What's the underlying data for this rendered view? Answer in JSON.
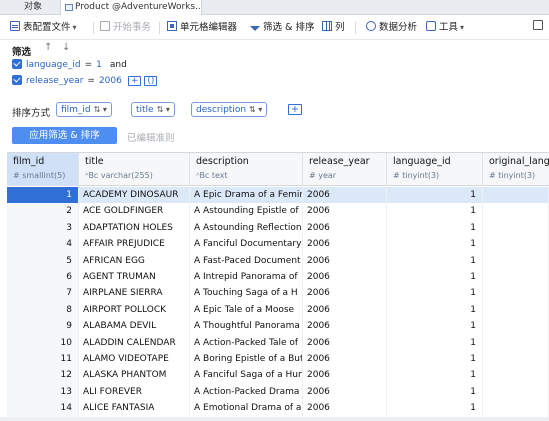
{
  "tabs": [
    {
      "label": "对象"
    },
    {
      "label": "Product @AdventureWorks..."
    }
  ],
  "toolbar": {
    "config_file": "表配置文件",
    "begin_txn": "开始事务",
    "cell_editor": "单元格编辑器",
    "filter_sort": "筛选 & 排序",
    "columns": "列",
    "data_analysis": "数据分析",
    "tools": "工具"
  },
  "filter": {
    "title": "筛选",
    "conditions": [
      {
        "field": "language_id",
        "op": "=",
        "value": "1",
        "logic": "and"
      },
      {
        "field": "release_year",
        "op": "=",
        "value": "2006",
        "add": "+",
        "expr": "()"
      }
    ]
  },
  "sort": {
    "label": "排序方式",
    "fields": [
      "film_id",
      "title",
      "description"
    ],
    "add": "+",
    "apply_button": "应用筛选 & 排序",
    "edited_text": "已编辑准则"
  },
  "grid": {
    "columns": [
      {
        "name": "film_id",
        "type": "smallint(5)",
        "type_icon": "#"
      },
      {
        "name": "title",
        "type": "varchar(255)",
        "type_icon": "ᴬBc"
      },
      {
        "name": "description",
        "type": "text",
        "type_icon": "ᴬBc"
      },
      {
        "name": "release_year",
        "type": "year",
        "type_icon": "#"
      },
      {
        "name": "language_id",
        "type": "tinyint(3)",
        "type_icon": "#"
      },
      {
        "name": "original_langu",
        "type": "tinyint(3)",
        "type_icon": "#"
      }
    ],
    "rows": [
      [
        "1",
        "ACADEMY DINOSAUR",
        "A Epic Drama of a Femin",
        "2006",
        "1",
        ""
      ],
      [
        "2",
        "ACE GOLDFINGER",
        "A Astounding Epistle of",
        "2006",
        "1",
        ""
      ],
      [
        "3",
        "ADAPTATION HOLES",
        "A Astounding Reflection",
        "2006",
        "1",
        ""
      ],
      [
        "4",
        "AFFAIR PREJUDICE",
        "A Fanciful Documentary",
        "2006",
        "1",
        ""
      ],
      [
        "5",
        "AFRICAN EGG",
        "A Fast-Paced Document",
        "2006",
        "1",
        ""
      ],
      [
        "6",
        "AGENT TRUMAN",
        "A Intrepid Panorama of",
        "2006",
        "1",
        ""
      ],
      [
        "7",
        "AIRPLANE SIERRA",
        "A Touching Saga of a H",
        "2006",
        "1",
        ""
      ],
      [
        "8",
        "AIRPORT POLLOCK",
        "A Epic Tale of a Moose",
        "2006",
        "1",
        ""
      ],
      [
        "9",
        "ALABAMA DEVIL",
        "A Thoughtful Panorama",
        "2006",
        "1",
        ""
      ],
      [
        "10",
        "ALADDIN CALENDAR",
        "A Action-Packed Tale of",
        "2006",
        "1",
        ""
      ],
      [
        "11",
        "ALAMO VIDEOTAPE",
        "A Boring Epistle of a But",
        "2006",
        "1",
        ""
      ],
      [
        "12",
        "ALASKA PHANTOM",
        "A Fanciful Saga of a Hun",
        "2006",
        "1",
        ""
      ],
      [
        "13",
        "ALI FOREVER",
        "A Action-Packed Drama",
        "2006",
        "1",
        ""
      ],
      [
        "14",
        "ALICE FANTASIA",
        "A Emotional Drama of a",
        "2006",
        "1",
        ""
      ]
    ]
  }
}
